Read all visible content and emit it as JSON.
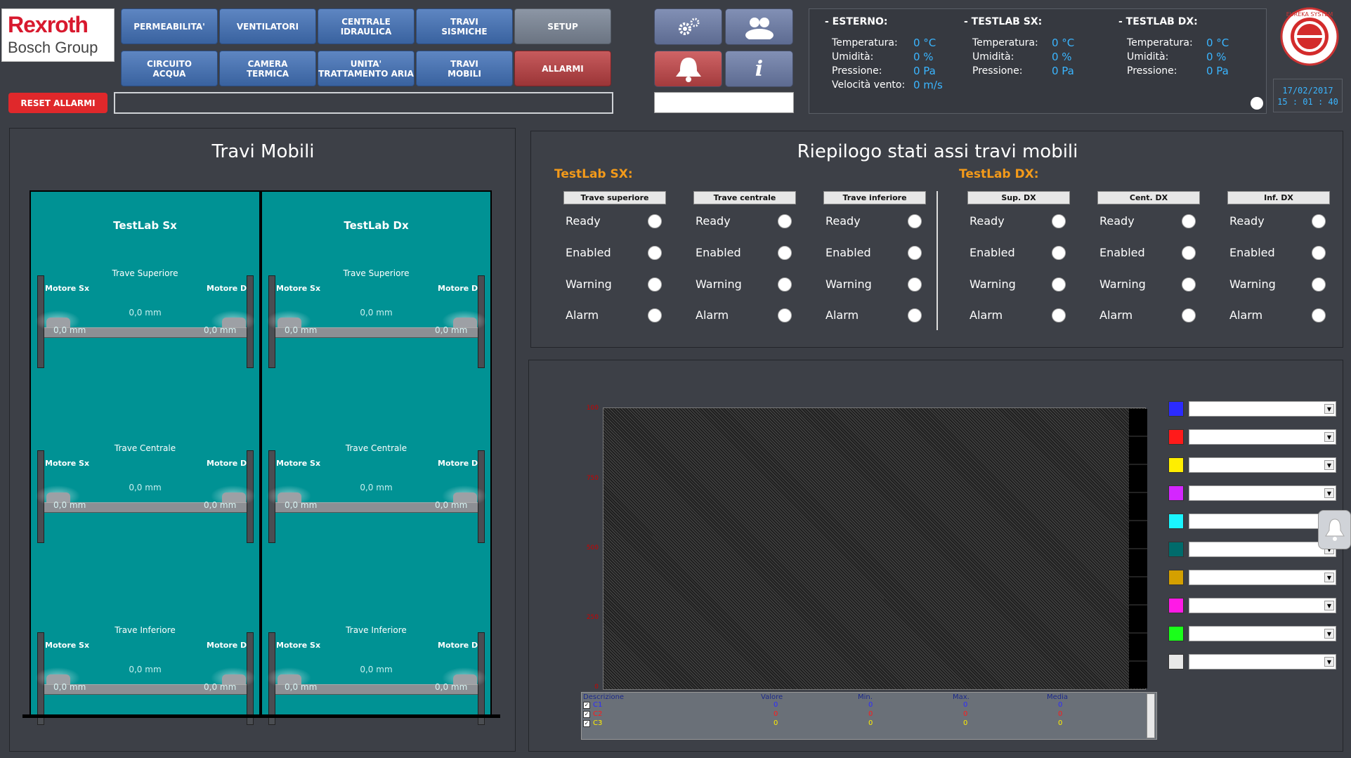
{
  "logo": {
    "line1": "Rexroth",
    "line2": "Bosch Group"
  },
  "nav": {
    "row1": [
      "PERMEABILITA'",
      "VENTILATORI",
      "CENTRALE\nIDRAULICA",
      "TRAVI\nSISMICHE",
      "SETUP"
    ],
    "row2": [
      "CIRCUITO\nACQUA",
      "CAMERA\nTERMICA",
      "UNITA'\nTRATTAMENTO ARIA",
      "TRAVI\nMOBILI",
      "ALLARMI"
    ]
  },
  "icons": [
    "gears-icon",
    "users-icon",
    "alarm-bell-icon",
    "info-icon"
  ],
  "reset_label": "RESET ALLARMI",
  "env": {
    "esterno": {
      "title": "- ESTERNO:",
      "temp_label": "Temperatura:",
      "temp": "0 °C",
      "hum_label": "Umidità:",
      "hum": "0 %",
      "pres_label": "Pressione:",
      "pres": "0 Pa",
      "wind_label": "Velocità vento:",
      "wind": "0 m/s"
    },
    "sx": {
      "title": "- TESTLAB SX:",
      "temp_label": "Temperatura:",
      "temp": "0 °C",
      "hum_label": "Umidità:",
      "hum": "0 %",
      "pres_label": "Pressione:",
      "pres": "0 Pa"
    },
    "dx": {
      "title": "- TESTLAB DX:",
      "temp_label": "Temperatura:",
      "temp": "0 °C",
      "hum_label": "Umidità:",
      "hum": "0 %",
      "pres_label": "Pressione:",
      "pres": "0 Pa"
    }
  },
  "brand_ring": "EUREKA SYSTEM",
  "datetime": {
    "date": "17/02/2017",
    "time": "15 : 01 : 40"
  },
  "travi": {
    "title": "Travi Mobili",
    "labs": [
      {
        "name": "TestLab Sx",
        "beams": [
          {
            "label": "Trave Superiore",
            "m_sx": "Motore Sx",
            "m_dx": "Motore Dx",
            "center": "0,0 mm",
            "left": "0,0 mm",
            "right": "0,0 mm"
          },
          {
            "label": "Trave Centrale",
            "m_sx": "Motore Sx",
            "m_dx": "Motore Dx",
            "center": "0,0 mm",
            "left": "0,0 mm",
            "right": "0,0 mm"
          },
          {
            "label": "Trave Inferiore",
            "m_sx": "Motore Sx",
            "m_dx": "Motore Dx",
            "center": "0,0 mm",
            "left": "0,0 mm",
            "right": "0,0 mm"
          }
        ]
      },
      {
        "name": "TestLab Dx",
        "beams": [
          {
            "label": "Trave Superiore",
            "m_sx": "Motore Sx",
            "m_dx": "Motore Dx",
            "center": "0,0 mm",
            "left": "0,0 mm",
            "right": "0,0 mm"
          },
          {
            "label": "Trave Centrale",
            "m_sx": "Motore Sx",
            "m_dx": "Motore Dx",
            "center": "0,0 mm",
            "left": "0,0 mm",
            "right": "0,0 mm"
          },
          {
            "label": "Trave Inferiore",
            "m_sx": "Motore Sx",
            "m_dx": "Motore Dx",
            "center": "0,0 mm",
            "left": "0,0 mm",
            "right": "0,0 mm"
          }
        ]
      }
    ]
  },
  "riepilogo": {
    "title": "Riepilogo stati assi travi mobili",
    "sx_title": "TestLab SX:",
    "dx_title": "TestLab DX:",
    "columns": [
      "Trave superiore",
      "Trave centrale",
      "Trave inferiore",
      "Sup. DX",
      "Cent. DX",
      "Inf. DX"
    ],
    "states": [
      "Ready",
      "Enabled",
      "Warning",
      "Alarm"
    ]
  },
  "trend": {
    "y_ticks": [
      "100",
      "750",
      "500",
      "250",
      "0"
    ],
    "swatch_colors": [
      "#2b2bff",
      "#ff1a1a",
      "#ffee00",
      "#d426ff",
      "#1af5ff",
      "#006b6b",
      "#d4a000",
      "#ff1ae6",
      "#1aff1a",
      "#e8e8e8"
    ],
    "legend": {
      "headers": [
        "Descrizione",
        "Valore",
        "Min.",
        "Max.",
        "Media"
      ],
      "rows": [
        {
          "name": "C1",
          "valore": "0",
          "min": "0",
          "max": "0",
          "media": "0",
          "color": "#2b2bff"
        },
        {
          "name": "C2",
          "valore": "0",
          "min": "0",
          "max": "0",
          "media": "0",
          "color": "#ff1a1a"
        },
        {
          "name": "C3",
          "valore": "0",
          "min": "0",
          "max": "0",
          "media": "0",
          "color": "#ffee00"
        }
      ]
    }
  }
}
